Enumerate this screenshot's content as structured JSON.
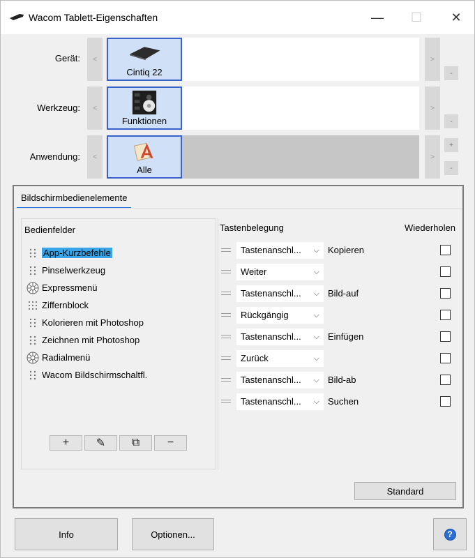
{
  "window": {
    "title": "Wacom Tablett-Eigenschaften",
    "minimize": "—",
    "maximize": "☐",
    "close": "✕"
  },
  "device_row": {
    "label": "Gerät:",
    "prev": "<",
    "next": ">",
    "tile_label": "Cintiq 22",
    "remove": "-"
  },
  "tool_row": {
    "label": "Werkzeug:",
    "prev": "<",
    "next": ">",
    "tile_label": "Funktionen",
    "remove": "-"
  },
  "app_row": {
    "label": "Anwendung:",
    "prev": "<",
    "next": ">",
    "tile_label": "Alle",
    "add": "+",
    "remove": "-"
  },
  "tabs": [
    {
      "label": "Bildschirmbedienelemente"
    }
  ],
  "left_panel": {
    "title": "Bedienfelder",
    "items": [
      {
        "label": "App-Kurzbefehle",
        "icon": "drag-dots-icon",
        "selected": true
      },
      {
        "label": "Pinselwerkzeug",
        "icon": "drag-dots-icon"
      },
      {
        "label": "Expressmenü",
        "icon": "radial-menu-icon"
      },
      {
        "label": "Ziffernblock",
        "icon": "keypad-dots-icon"
      },
      {
        "label": "Kolorieren mit Photoshop",
        "icon": "drag-dots-icon"
      },
      {
        "label": "Zeichnen mit Photoshop",
        "icon": "drag-dots-icon"
      },
      {
        "label": "Radialmenü",
        "icon": "radial-menu-icon"
      },
      {
        "label": "Wacom Bildschirmschaltfl.",
        "icon": "drag-dots-icon"
      }
    ],
    "toolbar": {
      "add": "+",
      "edit": "✎",
      "duplicate": "⧉",
      "remove": "−"
    }
  },
  "right_panel": {
    "head_assignment": "Tastenbelegung",
    "head_repeat": "Wiederholen",
    "rows": [
      {
        "select": "Tastenanschl...",
        "key": "Kopieren",
        "repeat": false
      },
      {
        "select": "Weiter",
        "key": "",
        "repeat": false
      },
      {
        "select": "Tastenanschl...",
        "key": "Bild-auf",
        "repeat": false
      },
      {
        "select": "Rückgängig",
        "key": "",
        "repeat": false
      },
      {
        "select": "Tastenanschl...",
        "key": "Einfügen",
        "repeat": false
      },
      {
        "select": "Zurück",
        "key": "",
        "repeat": false
      },
      {
        "select": "Tastenanschl...",
        "key": "Bild-ab",
        "repeat": false
      },
      {
        "select": "Tastenanschl...",
        "key": "Suchen",
        "repeat": false
      }
    ],
    "chevron": "⌵"
  },
  "buttons": {
    "standard": "Standard",
    "info": "Info",
    "options": "Optionen...",
    "help": "?"
  },
  "colors": {
    "selection": "#38a5e8",
    "tile_border": "#3a63c9",
    "tile_bg": "#cfe0f7",
    "tab_underline": "#2b79d8",
    "help": "#2b6fd6"
  }
}
